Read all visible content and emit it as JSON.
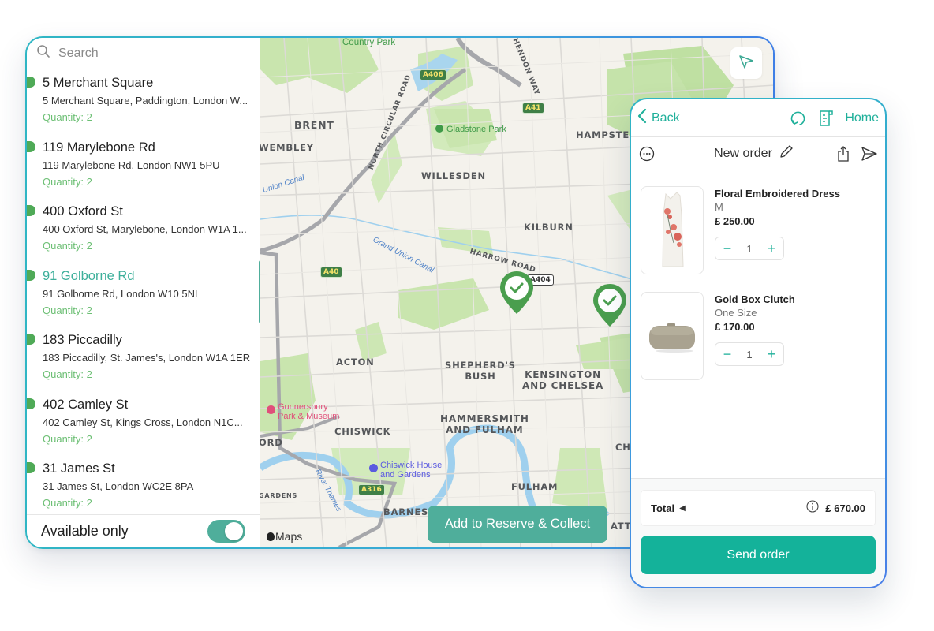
{
  "sidebar": {
    "search_placeholder": "Search",
    "stores": [
      {
        "name": "5 Merchant Square",
        "address": "5 Merchant Square, Paddington, London W...",
        "quantity": "Quantity: 2",
        "active": false
      },
      {
        "name": "119 Marylebone Rd",
        "address": "119 Marylebone Rd, London NW1 5PU",
        "quantity": "Quantity: 2",
        "active": false
      },
      {
        "name": "400 Oxford St",
        "address": "400 Oxford St, Marylebone, London W1A 1...",
        "quantity": "Quantity: 2",
        "active": false
      },
      {
        "name": "91 Golborne Rd",
        "address": "91 Golborne Rd, London W10 5NL",
        "quantity": "Quantity: 2",
        "active": true
      },
      {
        "name": "183 Piccadilly",
        "address": "183 Piccadilly, St. James's, London W1A 1ER",
        "quantity": "Quantity: 2",
        "active": false
      },
      {
        "name": "402 Camley St",
        "address": "402 Camley St, Kings Cross, London N1C...",
        "quantity": "Quantity: 2",
        "active": false
      },
      {
        "name": "31 James St",
        "address": "31 James St, London WC2E 8PA",
        "quantity": "Quantity: 2",
        "active": false
      }
    ],
    "available_only_label": "Available only",
    "available_only_on": true
  },
  "map": {
    "labels": {
      "country_park": "Country Park",
      "hendon_way": "HENDON WAY",
      "brent": "BRENT",
      "wembley": "WEMBLEY",
      "north_circular": "NORTH CIRCULAR ROAD",
      "gladstone_park": "Gladstone Park",
      "willesden": "WILLESDEN",
      "hampstead": "HAMPSTEAD",
      "kilburn": "KILBURN",
      "union_canal": "Union Canal",
      "grand_union_canal": "Grand Union Canal",
      "harrow_road": "HARROW ROAD",
      "acton": "ACTON",
      "shepherds_bush": "SHEPHERD'S\nBUSH",
      "kensington": "KENSINGTON\nAND CHELSEA",
      "gunnersbury": "Gunnersbury\nPark & Museum",
      "chiswick": "CHISWICK",
      "hammersmith": "HAMMERSMITH\nAND FULHAM",
      "ord": "ORD",
      "chiswick_house": "Chiswick House\nand Gardens",
      "river_thames": "River Thames",
      "gardens": "GARDENS",
      "fulham": "FULHAM",
      "barnes": "BARNES",
      "che": "CHE",
      "atter": "ATTER"
    },
    "road_shields": {
      "a406": "A406",
      "a41": "A41",
      "a40": "A40",
      "a404": "A404",
      "a316": "A316"
    },
    "attribution": "Maps",
    "add_button_label": "Add to Reserve & Collect"
  },
  "order": {
    "back_label": "Back",
    "home_label": "Home",
    "title": "New order",
    "items": [
      {
        "name": "Floral Embroidered Dress",
        "variant": "M",
        "price": "£ 250.00",
        "quantity": "1"
      },
      {
        "name": "Gold Box Clutch",
        "variant": "One Size",
        "price": "£ 170.00",
        "quantity": "1"
      }
    ],
    "total_label": "Total",
    "total_amount": "£ 670.00",
    "send_label": "Send order"
  },
  "colors": {
    "accent_teal": "#1fb09a",
    "button_teal": "#4fae9b",
    "marker_green": "#4faa57",
    "quantity_green": "#6cbf74"
  }
}
